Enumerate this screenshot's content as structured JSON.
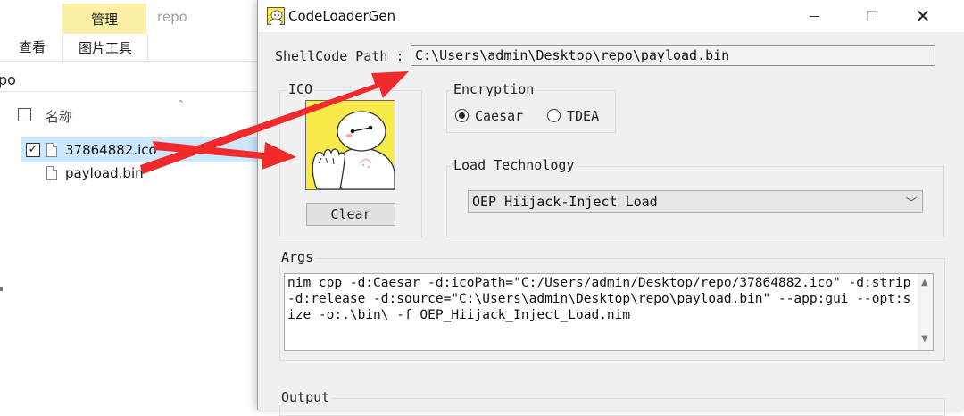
{
  "explorer": {
    "ribbon": {
      "manage_tab": "管理",
      "folder_title": "repo",
      "view_tab": "查看",
      "picture_tools_tab": "图片工具"
    },
    "address_text": "po",
    "column_header": "名称",
    "files": [
      {
        "name": "37864882.ico",
        "checked": true,
        "selected": true
      },
      {
        "name": "payload.bin",
        "checked": false,
        "selected": false
      }
    ],
    "row_check_mark": "✓"
  },
  "app": {
    "title": "CodeLoaderGen",
    "window_controls": {
      "minimize_icon": "minimize-icon",
      "maximize_icon": "maximize-icon",
      "close_symbol": "✕"
    },
    "shellcode_label": "ShellCode Path :",
    "shellcode_path": "C:\\Users\\admin\\Desktop\\repo\\payload.bin",
    "ico_group_title": "ICO",
    "clear_button": "Clear",
    "encryption": {
      "title": "Encryption",
      "options": [
        "Caesar",
        "TDEA"
      ],
      "selected": "Caesar"
    },
    "load_technology": {
      "title": "Load Technology",
      "selected": "OEP Hiijack-Inject Load",
      "chevron": "﹀"
    },
    "args": {
      "title": "Args",
      "text": "nim cpp -d:Caesar -d:icoPath=\"C:/Users/admin/Desktop/repo/37864882.ico\" -d:strip -d:release -d:source=\"C:\\Users\\admin\\Desktop\\repo\\payload.bin\" --app:gui --opt:size -o:.\\bin\\ -f OEP_Hiijack_Inject_Load.nim",
      "scroll_up": "▲",
      "scroll_down": "▼"
    },
    "output_title": "Output"
  },
  "colors": {
    "annotation_arrow": "#f02a2a",
    "selection_highlight": "#cce8ff",
    "ribbon_highlight": "#fbf0a6",
    "window_background": "#f0f0f0",
    "icon_background": "#f7ea4a"
  }
}
